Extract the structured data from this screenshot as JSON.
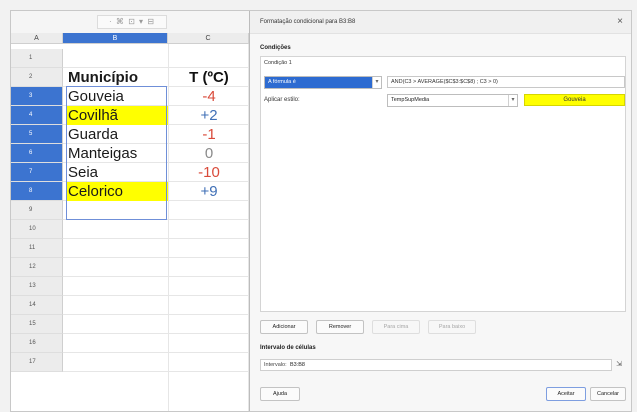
{
  "sheet": {
    "toolbar_hint": "· ⌘ ⊡ ▾ ⊟",
    "columns": [
      {
        "label": "A",
        "selected": false
      },
      {
        "label": "B",
        "selected": true
      },
      {
        "label": "C",
        "selected": false
      }
    ],
    "rows": [
      "1",
      "2",
      "3",
      "4",
      "5",
      "6",
      "7",
      "8",
      "9",
      "10",
      "11",
      "12",
      "13",
      "14",
      "15",
      "16",
      "17"
    ],
    "header": {
      "municipio": "Município",
      "temp": "T (ºC)"
    },
    "data": [
      {
        "name": "Gouveia",
        "temp": "-4",
        "highlight": false
      },
      {
        "name": "Covilhã",
        "temp": "+2",
        "highlight": true
      },
      {
        "name": "Guarda",
        "temp": "-1",
        "highlight": false
      },
      {
        "name": "Manteigas",
        "temp": "0",
        "highlight": false
      },
      {
        "name": "Seia",
        "temp": "-10",
        "highlight": false
      },
      {
        "name": "Celorico",
        "temp": "+9",
        "highlight": true
      }
    ],
    "colors": {
      "negative": "#d94a3a",
      "positive": "#3f6fb6",
      "zero": "#8a8a8a",
      "highlight": "#ffff00",
      "selection": "#3c74d0"
    }
  },
  "dialog": {
    "title": "Formatação condicional para B3:B8",
    "close": "×",
    "conditions_label": "Condições",
    "condition_title": "Condição 1",
    "type_value": "A fórmula é",
    "formula": "AND(C3 > AVERAGE($C$3:$C$8) ; C3 > 0)",
    "apply_style_label": "Aplicar estilo:",
    "style_value": "TempSupMedia",
    "preview_text": "Gouveia",
    "buttons": {
      "add": "Adicionar",
      "remove": "Remover",
      "up": "Para cima",
      "down": "Para baixo"
    },
    "range_section_label": "Intervalo de células",
    "range_label": "Intervalo:",
    "range_value": "B3:B8",
    "help": "Ajuda",
    "ok": "Aceitar",
    "cancel": "Cancelar"
  }
}
